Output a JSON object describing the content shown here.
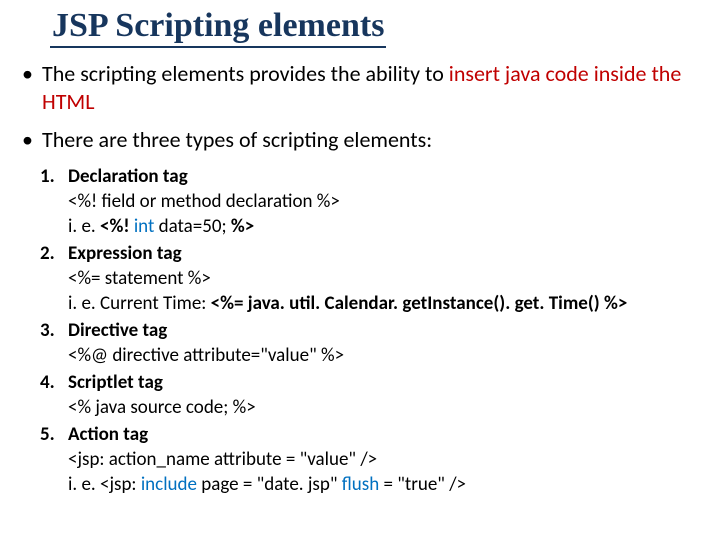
{
  "title": "JSP Scripting elements",
  "bullets": {
    "b1_pre": "The scripting elements provides the ability to ",
    "b1_red": "insert java code inside the HTML",
    "b2": "There are three types of scripting elements:"
  },
  "items": [
    {
      "head": "Declaration tag",
      "l1": "<%!  field or method declaration %>",
      "l2_pre": "i. e. ",
      "l2_b": "<%! ",
      "l2_kw": "int",
      "l2_post": " data=50; ",
      "l2_end": "%>"
    },
    {
      "head": "Expression tag",
      "l1": "<%=  statement %>",
      "l2_pre": "i. e. Current Time: ",
      "l2_b": "<%= java. util. Calendar. getInstance(). get. Time() %>"
    },
    {
      "head": "Directive tag",
      "l1": "<%@ directive attribute=\"value\" %>"
    },
    {
      "head": "Scriptlet tag",
      "l1": "<%  java source code; %>"
    },
    {
      "head": "Action tag",
      "l1": "<jsp: action_name attribute = \"value\" />",
      "l2_pre": "i. e. <jsp: ",
      "l2_kw1": "include",
      "l2_mid": " page = \"date. jsp\" ",
      "l2_kw2": "flush",
      "l2_post": " = \"true\" />"
    }
  ]
}
